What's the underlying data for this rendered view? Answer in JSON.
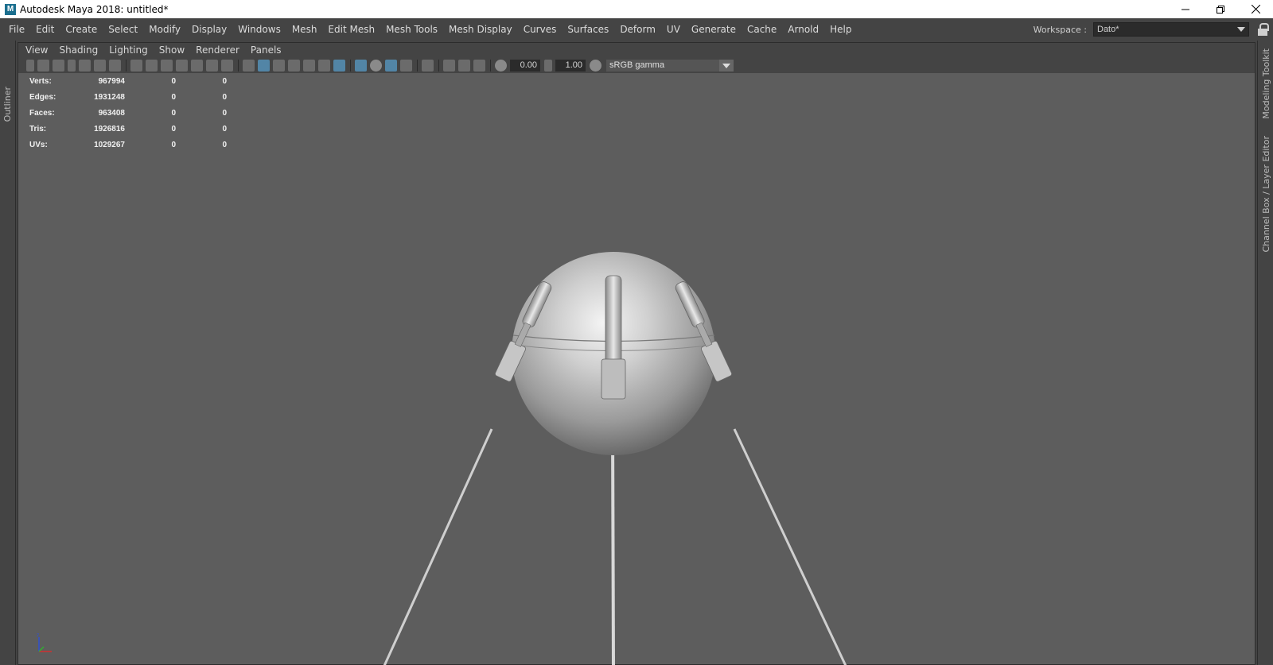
{
  "window": {
    "app_icon": "M",
    "title": "Autodesk Maya 2018: untitled*",
    "controls": [
      "minimize-icon",
      "restore-icon",
      "close-icon"
    ]
  },
  "menubar": {
    "items": [
      "File",
      "Edit",
      "Create",
      "Select",
      "Modify",
      "Display",
      "Windows",
      "Mesh",
      "Edit Mesh",
      "Mesh Tools",
      "Mesh Display",
      "Curves",
      "Surfaces",
      "Deform",
      "UV",
      "Generate",
      "Cache",
      "Arnold",
      "Help"
    ]
  },
  "workspace": {
    "label": "Workspace :",
    "value": "Dato*"
  },
  "side_tabs": {
    "left": "Outliner",
    "right_top": "Modeling Toolkit",
    "right_bottom": "Channel Box / Layer Editor"
  },
  "panel": {
    "menu": [
      "View",
      "Shading",
      "Lighting",
      "Show",
      "Renderer",
      "Panels"
    ],
    "exposure": "0.00",
    "gamma": "1.00",
    "color_space": "sRGB gamma"
  },
  "hud": {
    "rows": [
      {
        "label": "Verts:",
        "v1": "967994",
        "v2": "0",
        "v3": "0"
      },
      {
        "label": "Edges:",
        "v1": "1931248",
        "v2": "0",
        "v3": "0"
      },
      {
        "label": "Faces:",
        "v1": "963408",
        "v2": "0",
        "v3": "0"
      },
      {
        "label": "Tris:",
        "v1": "1926816",
        "v2": "0",
        "v3": "0"
      },
      {
        "label": "UVs:",
        "v1": "1029267",
        "v2": "0",
        "v3": "0"
      }
    ]
  },
  "colors": {
    "ui_bg": "#444444",
    "viewport_bg": "#5d5d5d",
    "active_icon": "#5285a6",
    "axis_x": "#d03030",
    "axis_y": "#30b030",
    "axis_z": "#3050d0"
  }
}
